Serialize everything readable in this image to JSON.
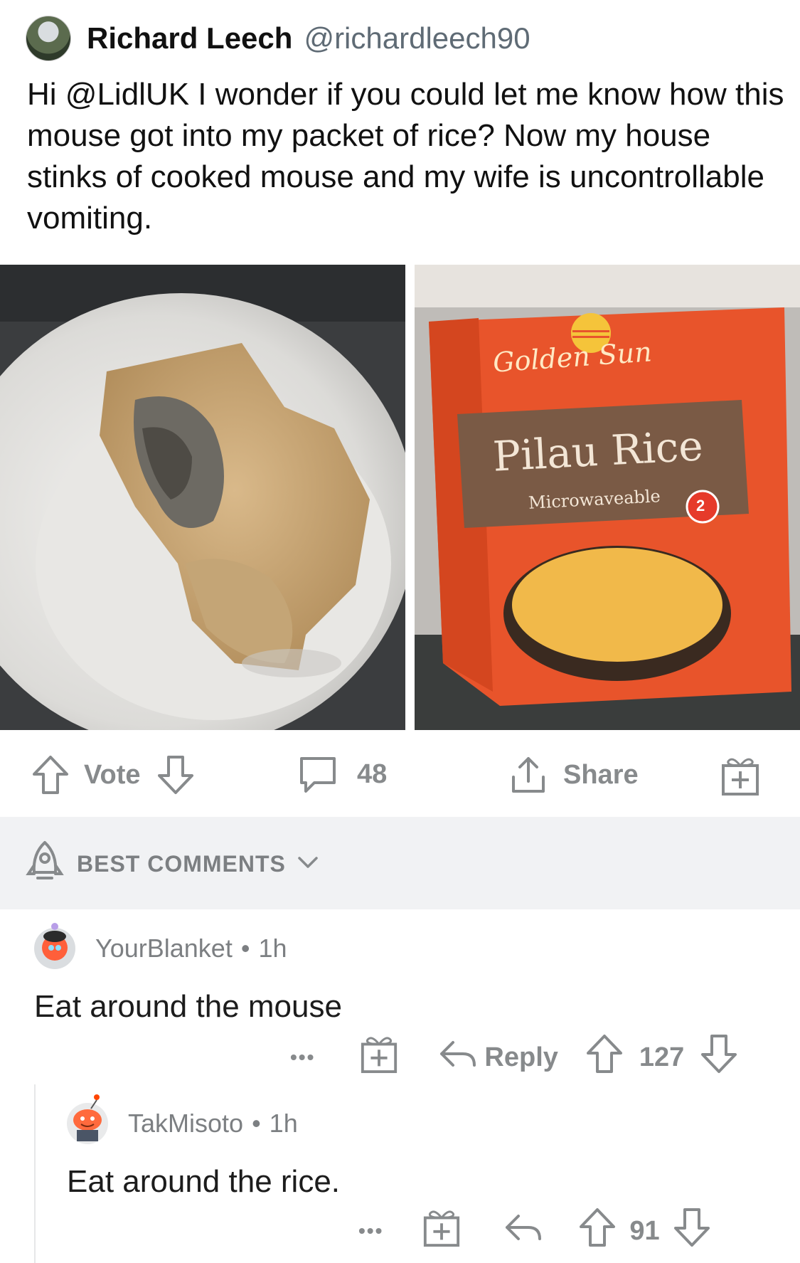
{
  "tweet": {
    "name": "Richard Leech",
    "handle": "@richardleech90",
    "text": "Hi @LidlUK I wonder if you could let me know how this mouse got into my packet of rice? Now my house stinks of cooked mouse and my wife is uncontrollable vomiting."
  },
  "package": {
    "brand": "Golden Sun",
    "product": "Pilau Rice",
    "subtitle": "Microwaveable",
    "badge": "2"
  },
  "post_actions": {
    "vote_label": "Vote",
    "comment_count": "48",
    "share_label": "Share"
  },
  "sort": {
    "label": "BEST COMMENTS"
  },
  "comments": [
    {
      "user": "YourBlanket",
      "separator": "•",
      "time": "1h",
      "body": "Eat around the mouse",
      "more": "•••",
      "reply_label": "Reply",
      "score": "127"
    },
    {
      "user": "TakMisoto",
      "separator": "•",
      "time": "1h",
      "body": "Eat around the rice.",
      "more": "•••",
      "score": "91"
    }
  ],
  "colors": {
    "icon_gray": "#878a8c",
    "sort_bg": "#f1f2f4",
    "package_orange": "#e8542b"
  }
}
